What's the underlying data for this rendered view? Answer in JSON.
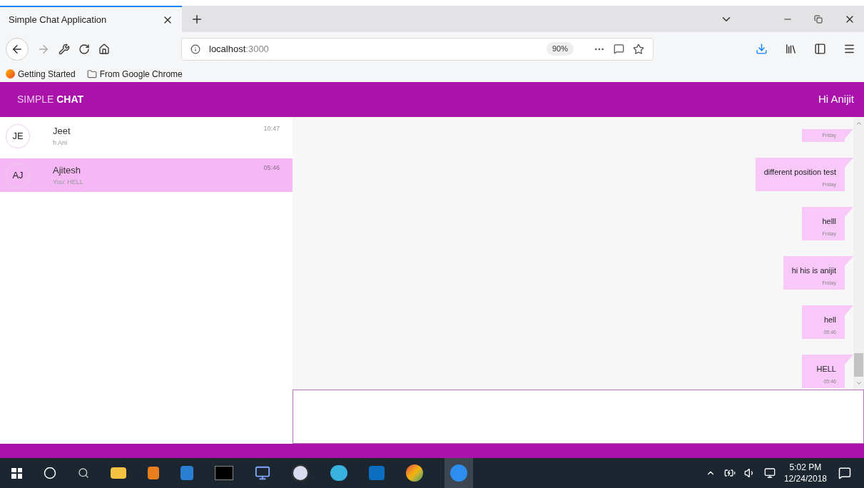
{
  "browser": {
    "tab": {
      "title": "Simple Chat Application",
      "selected": true
    },
    "url_host": "localhost",
    "url_port": ":3000",
    "zoom": "90%",
    "bookmarks": [
      "Getting Started",
      "From Google Chrome"
    ]
  },
  "header": {
    "brand_light": "SIMPLE",
    "brand_bold": "CHAT",
    "greeting": "Hi Anijit"
  },
  "conversations": [
    {
      "initials": "JE",
      "name": "Jeet",
      "preview": "h Ani",
      "time": "10:47",
      "selected": false
    },
    {
      "initials": "AJ",
      "name": "Ajitesh",
      "preview": "You: HELL",
      "time": "05:46",
      "selected": true
    }
  ],
  "messages": [
    {
      "time": "Friday"
    },
    {
      "text": "different position test",
      "time": "Friday"
    },
    {
      "text": "helll",
      "time": "Friday"
    },
    {
      "text": "hi his is anijit",
      "time": "Friday"
    },
    {
      "text": "hell",
      "time": "05:46"
    },
    {
      "text": "HELL",
      "time": "05:46"
    }
  ],
  "taskbar": {
    "time": "5:02 PM",
    "date": "12/24/2018"
  }
}
